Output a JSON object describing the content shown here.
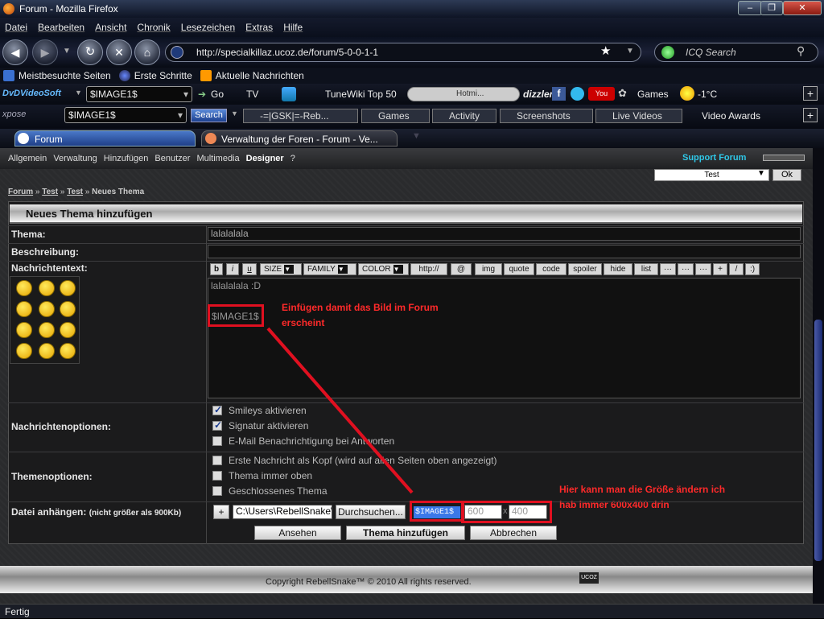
{
  "window": {
    "title": "Forum - Mozilla Firefox",
    "min": "–",
    "max": "❐",
    "close": "✕"
  },
  "menu": [
    "Datei",
    "Bearbeiten",
    "Ansicht",
    "Chronik",
    "Lesezeichen",
    "Extras",
    "Hilfe"
  ],
  "nav": {
    "url": "http://specialkillaz.ucoz.de/forum/5-0-0-1-1",
    "search_placeholder": "ICQ Search"
  },
  "bookmarks": [
    "Meistbesuchte Seiten",
    "Erste Schritte",
    "Aktuelle Nachrichten"
  ],
  "toolbar1": {
    "brand": "DvDVideoSoft",
    "select": "$IMAGE1$",
    "go": "Go",
    "tv": "TV",
    "tunewiki": "TuneWiki Top 50",
    "hotmix": "Hotmi...",
    "dizzler": "dizzler",
    "games": "Games",
    "weather": "-1°C"
  },
  "toolbar2": {
    "brand": "xpose",
    "select": "$IMAGE1$",
    "search": "Search",
    "ggsk": "-=|GSK|=-Reb...",
    "games": "Games",
    "activity": "Activity",
    "screenshots": "Screenshots",
    "live_videos": "Live Videos",
    "video_awards": "Video Awards"
  },
  "tabs": [
    {
      "label": "Forum"
    },
    {
      "label": "Verwaltung der Foren - Forum - Ve..."
    }
  ],
  "forum_nav": {
    "items": [
      "Allgemein",
      "Verwaltung",
      "Hinzufügen",
      "Benutzer",
      "Multimedia",
      "Designer",
      "?"
    ],
    "support": "Support Forum",
    "select": "Test",
    "ok": "Ok"
  },
  "breadcrumb": {
    "forum": "Forum",
    "sep": "»",
    "test1": "Test",
    "test2": "Test",
    "current": "Neues Thema"
  },
  "panel": {
    "title": "Neues Thema hinzufügen",
    "thema_label": "Thema:",
    "thema_value": "lalalalala",
    "beschreibung_label": "Beschreibung:",
    "nachricht_label": "Nachrichtentext:",
    "editor_buttons": [
      "b",
      "i",
      "u",
      "SIZE",
      "FAMILY",
      "COLOR",
      "http://",
      "@",
      "img",
      "quote",
      "code",
      "spoiler",
      "hide",
      "list",
      "···",
      "···",
      "···",
      "+",
      "/",
      ":)"
    ],
    "message_text": "lalalalala :D",
    "image_tag": "$IMAGE1$",
    "nachrichtenoptionen_label": "Nachrichtenoptionen:",
    "msg_opts": [
      {
        "label": "Smileys aktivieren",
        "checked": true
      },
      {
        "label": "Signatur aktivieren",
        "checked": true
      },
      {
        "label": "E-Mail Benachrichtigung bei Antworten",
        "checked": false
      }
    ],
    "themenoptionen_label": "Themenoptionen:",
    "topic_opts": [
      {
        "label": "Erste Nachricht als Kopf (wird auf allen Seiten oben angezeigt)"
      },
      {
        "label": "Thema immer oben"
      },
      {
        "label": "Geschlossenes Thema"
      }
    ],
    "datei_label": "Datei anhängen:",
    "datei_note": "(nicht größer als 900Kb)",
    "plus": "+",
    "file_path": "C:\\Users\\RebellSnake\\D",
    "browse": "Durchsuchen...",
    "image_code": "$IMAGE1$",
    "width": "600",
    "x": "x",
    "height": "400",
    "btn_preview": "Ansehen",
    "btn_submit": "Thema hinzufügen",
    "btn_cancel": "Abbrechen"
  },
  "annotations": {
    "a1_line1": "Einfügen damit das Bild im Forum",
    "a1_line2": "erscheint",
    "a2_line1": "Hier kann man die Größe ändern ich",
    "a2_line2": "hab immer 600x400 drin"
  },
  "footer": {
    "copyright": "Copyright RebellSnake™ © 2010 All rights reserved.",
    "ucoz": "UCOZ"
  },
  "status": "Fertig"
}
